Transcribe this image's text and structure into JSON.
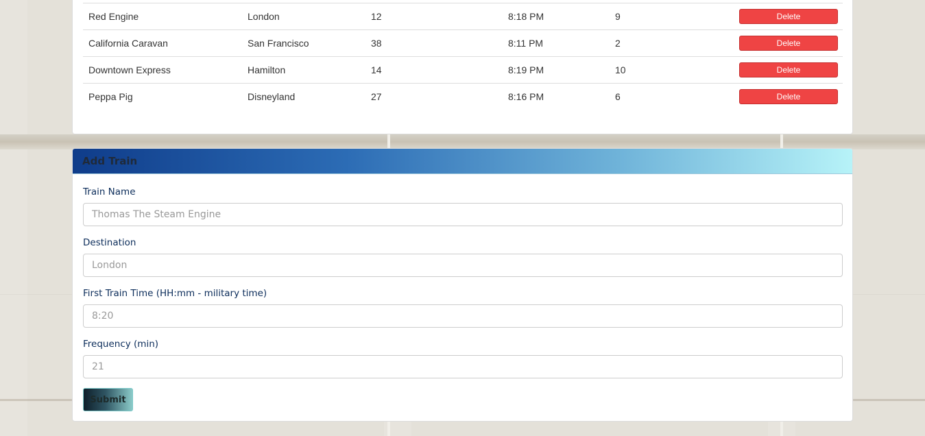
{
  "schedule": {
    "rows": [
      {
        "name": "Red Engine",
        "destination": "London",
        "frequency": "12",
        "next_arrival": "8:18 PM",
        "minutes_away": "9",
        "action": "Delete"
      },
      {
        "name": "California Caravan",
        "destination": "San Francisco",
        "frequency": "38",
        "next_arrival": "8:11 PM",
        "minutes_away": "2",
        "action": "Delete"
      },
      {
        "name": "Downtown Express",
        "destination": "Hamilton",
        "frequency": "14",
        "next_arrival": "8:19 PM",
        "minutes_away": "10",
        "action": "Delete"
      },
      {
        "name": "Peppa Pig",
        "destination": "Disneyland",
        "frequency": "27",
        "next_arrival": "8:16 PM",
        "minutes_away": "6",
        "action": "Delete"
      }
    ]
  },
  "add_train": {
    "title": "Add Train",
    "fields": [
      {
        "label": "Train Name",
        "placeholder": "Thomas The Steam Engine",
        "value": ""
      },
      {
        "label": "Destination",
        "placeholder": "London",
        "value": ""
      },
      {
        "label": "First Train Time (HH:mm - military time)",
        "placeholder": "8:20",
        "value": ""
      },
      {
        "label": "Frequency (min)",
        "placeholder": "21",
        "value": ""
      }
    ],
    "submit_label": "Submit"
  },
  "colors": {
    "delete_button": "#ef4444",
    "label_text": "#0b2c5a",
    "heading_gradient_start": "#0f3c8a",
    "heading_gradient_end": "#b7f3f8"
  }
}
